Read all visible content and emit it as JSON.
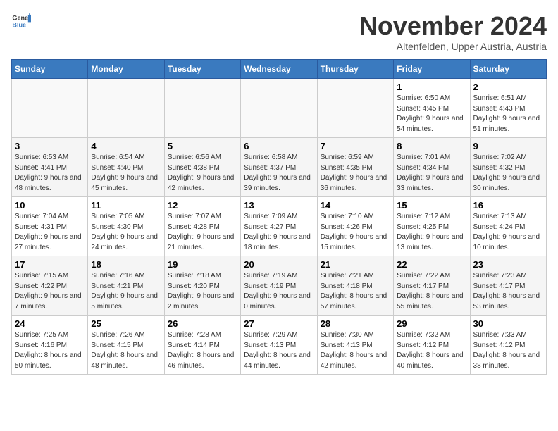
{
  "logo": {
    "general": "General",
    "blue": "Blue"
  },
  "title": "November 2024",
  "subtitle": "Altenfelden, Upper Austria, Austria",
  "days_of_week": [
    "Sunday",
    "Monday",
    "Tuesday",
    "Wednesday",
    "Thursday",
    "Friday",
    "Saturday"
  ],
  "weeks": [
    [
      {
        "day": "",
        "info": ""
      },
      {
        "day": "",
        "info": ""
      },
      {
        "day": "",
        "info": ""
      },
      {
        "day": "",
        "info": ""
      },
      {
        "day": "",
        "info": ""
      },
      {
        "day": "1",
        "info": "Sunrise: 6:50 AM\nSunset: 4:45 PM\nDaylight: 9 hours and 54 minutes."
      },
      {
        "day": "2",
        "info": "Sunrise: 6:51 AM\nSunset: 4:43 PM\nDaylight: 9 hours and 51 minutes."
      }
    ],
    [
      {
        "day": "3",
        "info": "Sunrise: 6:53 AM\nSunset: 4:41 PM\nDaylight: 9 hours and 48 minutes."
      },
      {
        "day": "4",
        "info": "Sunrise: 6:54 AM\nSunset: 4:40 PM\nDaylight: 9 hours and 45 minutes."
      },
      {
        "day": "5",
        "info": "Sunrise: 6:56 AM\nSunset: 4:38 PM\nDaylight: 9 hours and 42 minutes."
      },
      {
        "day": "6",
        "info": "Sunrise: 6:58 AM\nSunset: 4:37 PM\nDaylight: 9 hours and 39 minutes."
      },
      {
        "day": "7",
        "info": "Sunrise: 6:59 AM\nSunset: 4:35 PM\nDaylight: 9 hours and 36 minutes."
      },
      {
        "day": "8",
        "info": "Sunrise: 7:01 AM\nSunset: 4:34 PM\nDaylight: 9 hours and 33 minutes."
      },
      {
        "day": "9",
        "info": "Sunrise: 7:02 AM\nSunset: 4:32 PM\nDaylight: 9 hours and 30 minutes."
      }
    ],
    [
      {
        "day": "10",
        "info": "Sunrise: 7:04 AM\nSunset: 4:31 PM\nDaylight: 9 hours and 27 minutes."
      },
      {
        "day": "11",
        "info": "Sunrise: 7:05 AM\nSunset: 4:30 PM\nDaylight: 9 hours and 24 minutes."
      },
      {
        "day": "12",
        "info": "Sunrise: 7:07 AM\nSunset: 4:28 PM\nDaylight: 9 hours and 21 minutes."
      },
      {
        "day": "13",
        "info": "Sunrise: 7:09 AM\nSunset: 4:27 PM\nDaylight: 9 hours and 18 minutes."
      },
      {
        "day": "14",
        "info": "Sunrise: 7:10 AM\nSunset: 4:26 PM\nDaylight: 9 hours and 15 minutes."
      },
      {
        "day": "15",
        "info": "Sunrise: 7:12 AM\nSunset: 4:25 PM\nDaylight: 9 hours and 13 minutes."
      },
      {
        "day": "16",
        "info": "Sunrise: 7:13 AM\nSunset: 4:24 PM\nDaylight: 9 hours and 10 minutes."
      }
    ],
    [
      {
        "day": "17",
        "info": "Sunrise: 7:15 AM\nSunset: 4:22 PM\nDaylight: 9 hours and 7 minutes."
      },
      {
        "day": "18",
        "info": "Sunrise: 7:16 AM\nSunset: 4:21 PM\nDaylight: 9 hours and 5 minutes."
      },
      {
        "day": "19",
        "info": "Sunrise: 7:18 AM\nSunset: 4:20 PM\nDaylight: 9 hours and 2 minutes."
      },
      {
        "day": "20",
        "info": "Sunrise: 7:19 AM\nSunset: 4:19 PM\nDaylight: 9 hours and 0 minutes."
      },
      {
        "day": "21",
        "info": "Sunrise: 7:21 AM\nSunset: 4:18 PM\nDaylight: 8 hours and 57 minutes."
      },
      {
        "day": "22",
        "info": "Sunrise: 7:22 AM\nSunset: 4:17 PM\nDaylight: 8 hours and 55 minutes."
      },
      {
        "day": "23",
        "info": "Sunrise: 7:23 AM\nSunset: 4:17 PM\nDaylight: 8 hours and 53 minutes."
      }
    ],
    [
      {
        "day": "24",
        "info": "Sunrise: 7:25 AM\nSunset: 4:16 PM\nDaylight: 8 hours and 50 minutes."
      },
      {
        "day": "25",
        "info": "Sunrise: 7:26 AM\nSunset: 4:15 PM\nDaylight: 8 hours and 48 minutes."
      },
      {
        "day": "26",
        "info": "Sunrise: 7:28 AM\nSunset: 4:14 PM\nDaylight: 8 hours and 46 minutes."
      },
      {
        "day": "27",
        "info": "Sunrise: 7:29 AM\nSunset: 4:13 PM\nDaylight: 8 hours and 44 minutes."
      },
      {
        "day": "28",
        "info": "Sunrise: 7:30 AM\nSunset: 4:13 PM\nDaylight: 8 hours and 42 minutes."
      },
      {
        "day": "29",
        "info": "Sunrise: 7:32 AM\nSunset: 4:12 PM\nDaylight: 8 hours and 40 minutes."
      },
      {
        "day": "30",
        "info": "Sunrise: 7:33 AM\nSunset: 4:12 PM\nDaylight: 8 hours and 38 minutes."
      }
    ]
  ]
}
